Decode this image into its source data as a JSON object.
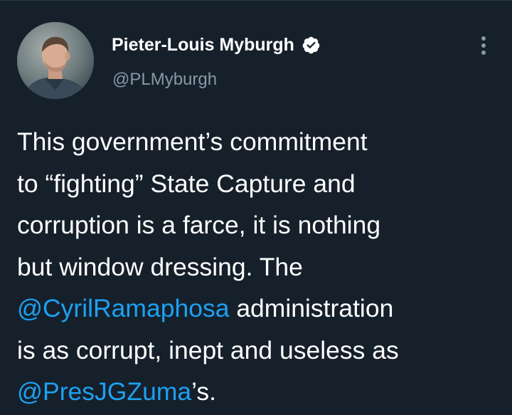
{
  "author": {
    "display_name": "Pieter-Louis Myburgh",
    "handle": "@PLMyburgh",
    "verified": true,
    "avatar": "profile-photo"
  },
  "more_icon": "more-vertical-icon",
  "verified_icon": "verified-badge-icon",
  "colors": {
    "background": "#15202b",
    "text": "#ffffff",
    "secondary_text": "#8899a6",
    "mention": "#1da1f2"
  },
  "tweet": {
    "line1": "This government’s commitment",
    "line2": "to “fighting” State Capture and",
    "line3": "corruption is a farce, it is nothing",
    "line4": "but window dressing. The",
    "mention1": "@CyrilRamaphosa",
    "line5_rest": " administration",
    "line6": "is as corrupt, inept and useless as",
    "mention2": "@PresJGZuma",
    "line7_rest": "’s."
  }
}
